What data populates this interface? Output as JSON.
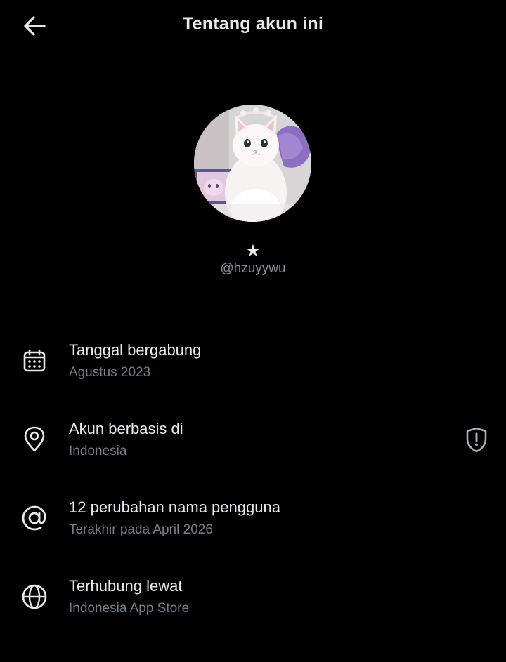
{
  "header": {
    "title": "Tentang akun ini",
    "back_icon": "arrow-left-icon"
  },
  "profile": {
    "display_name": "★",
    "handle": "@hzuyywu"
  },
  "info_rows": [
    {
      "icon": "calendar-icon",
      "label": "Tanggal bergabung",
      "sub": "Agustus 2023"
    },
    {
      "icon": "location-pin-icon",
      "label": "Akun berbasis di",
      "sub": "Indonesia",
      "action_icon": "shield-alert-icon"
    },
    {
      "icon": "at-sign-icon",
      "label": "12 perubahan nama pengguna",
      "sub": "Terakhir pada April 2026"
    },
    {
      "icon": "globe-icon",
      "label": "Terhubung lewat",
      "sub": "Indonesia App Store"
    }
  ],
  "colors": {
    "background": "#000000",
    "primary_text": "#e7e9ea",
    "secondary_text": "#787d83"
  }
}
